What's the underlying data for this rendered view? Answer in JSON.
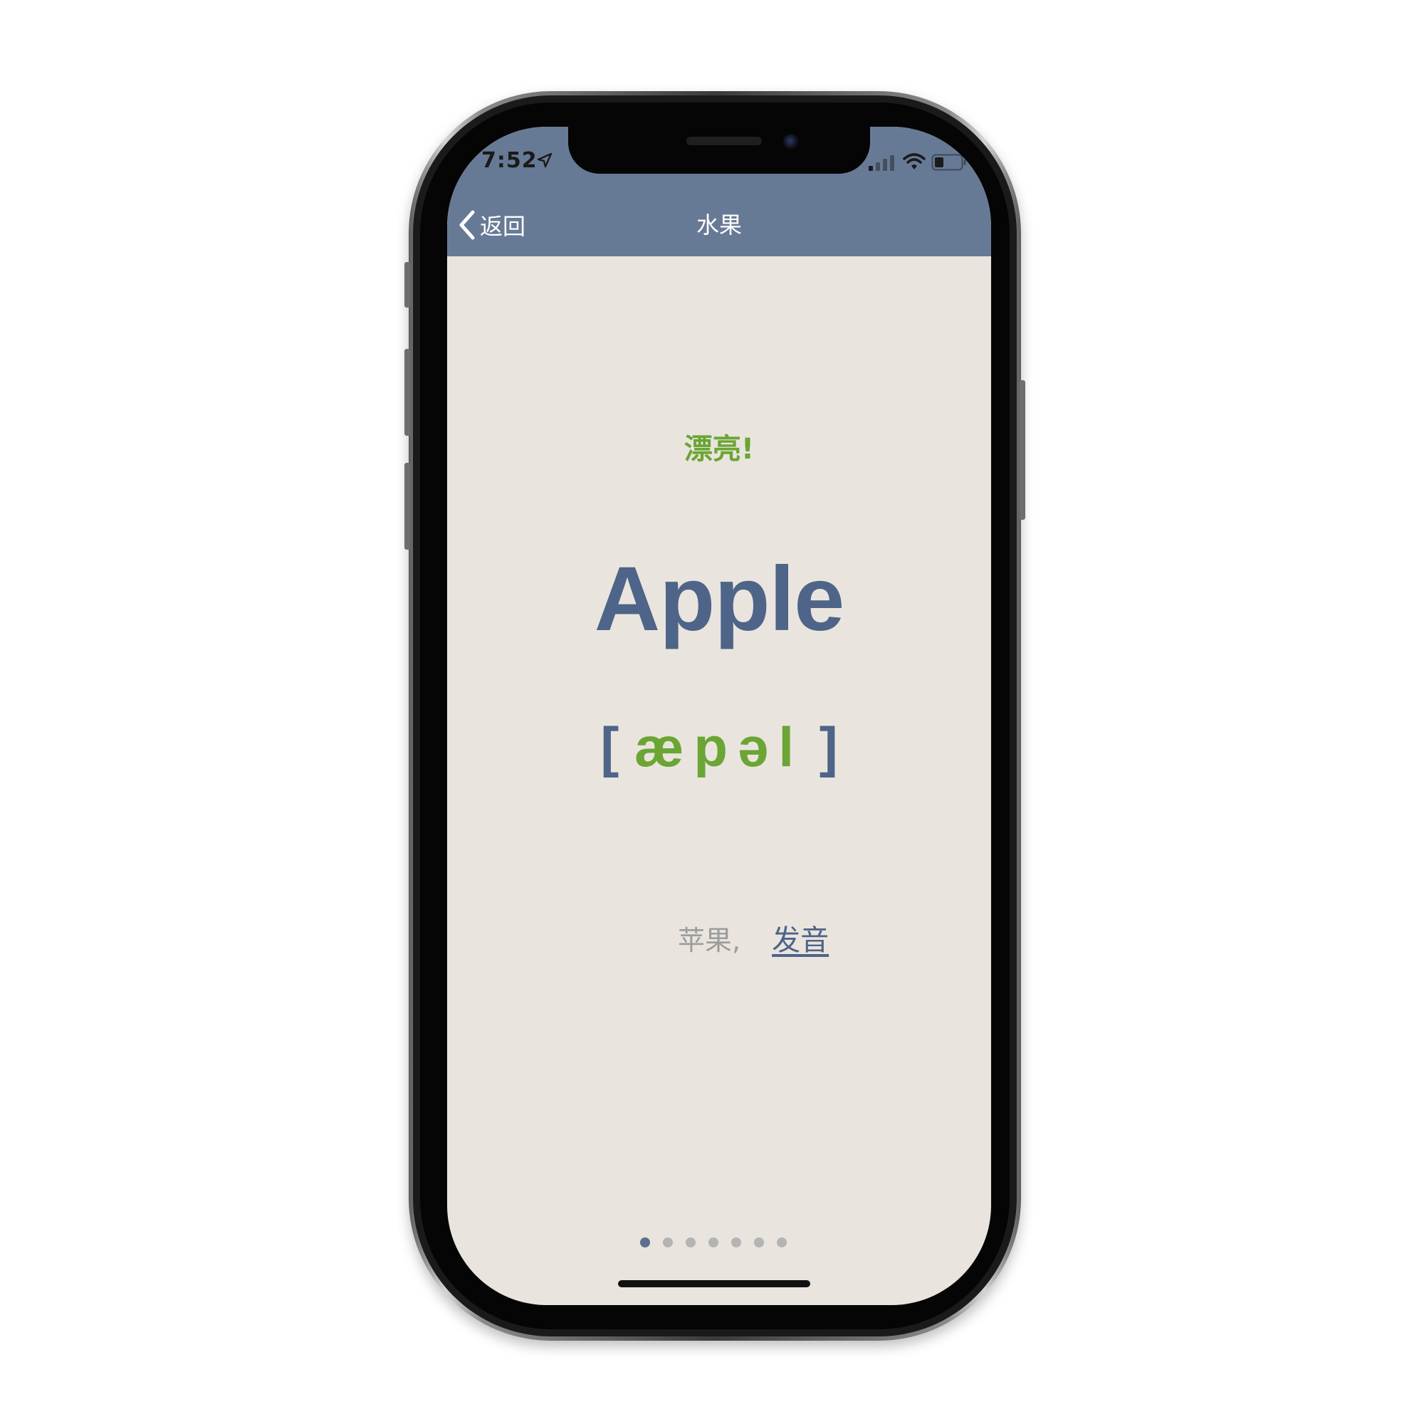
{
  "status_bar": {
    "time": "7:52"
  },
  "nav": {
    "back_label": "返回",
    "title": "水果"
  },
  "card": {
    "praise": "漂亮!",
    "word": "Apple",
    "phonetic_open": "[",
    "phonetic": "æpəl",
    "phonetic_close": "]",
    "meaning": "苹果,",
    "pronounce_label": "发音"
  },
  "pager": {
    "total_pages": 7,
    "current_page": 1
  },
  "colors": {
    "header": "#677a95",
    "background": "#e9e5de",
    "accent_green": "#6ba534",
    "accent_blue": "#4e6488"
  }
}
